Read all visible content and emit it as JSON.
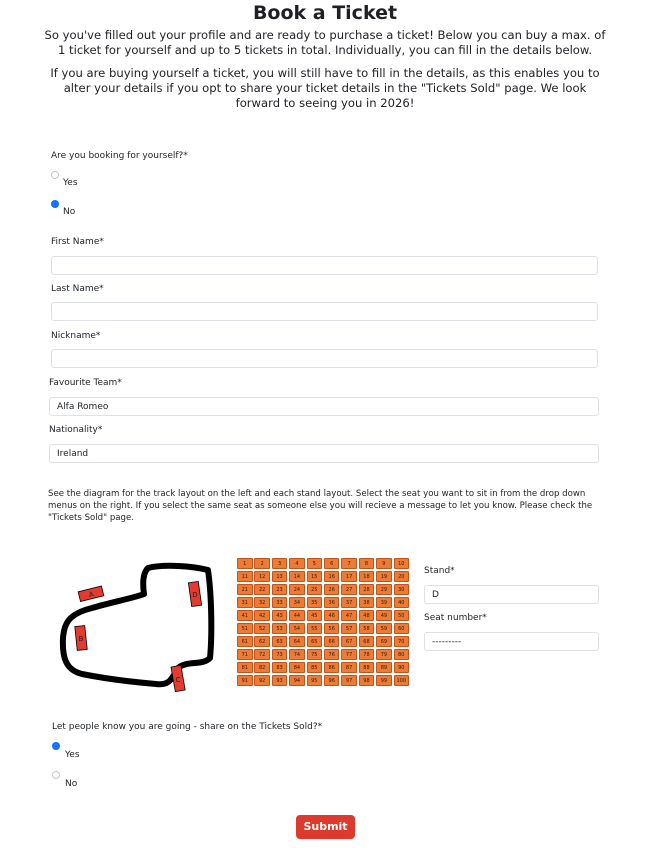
{
  "page": {
    "title": "Book a Ticket",
    "intro_1": "So you've filled out your profile and are ready to purchase a ticket! Below you can buy a max. of 1 ticket for yourself and up to 5 tickets in total. Individually, you can fill in the details below.",
    "intro_2": "If you are buying yourself a ticket, you will still have to fill in the details, as this enables you to alter your details if you opt to share your ticket details in the \"Tickets Sold\" page. We look forward to seeing you in 2026!"
  },
  "form": {
    "booking_self": {
      "label": "Are you booking for yourself?*",
      "options": [
        {
          "label": "Yes",
          "checked": false
        },
        {
          "label": "No",
          "checked": true
        }
      ]
    },
    "first_name": {
      "label": "First Name*",
      "value": ""
    },
    "last_name": {
      "label": "Last Name*",
      "value": ""
    },
    "nickname": {
      "label": "Nickname*",
      "value": ""
    },
    "favourite_team": {
      "label": "Favourite Team*",
      "value": "Alfa Romeo"
    },
    "nationality": {
      "label": "Nationality*",
      "value": "Ireland"
    },
    "seat_description": "See the diagram for the track layout on the left and each stand layout. Select the seat you want to sit in from the drop down menus on the right. If you select the same seat as someone else you will recieve a message to let you know. Please check the \"Tickets Sold\" page.",
    "stand": {
      "label": "Stand*",
      "value": "D"
    },
    "seat_number": {
      "label": "Seat number*",
      "value": "---------"
    },
    "share": {
      "label": "Let people know you are going - share on the Tickets Sold?*",
      "options": [
        {
          "label": "Yes",
          "checked": true
        },
        {
          "label": "No",
          "checked": false
        }
      ]
    },
    "submit_label": "Submit"
  },
  "track": {
    "stands": [
      "A",
      "B",
      "C",
      "D"
    ],
    "track_color": "#000000",
    "stand_color": "#e53a2f"
  },
  "seat_grid": {
    "seats": [
      1,
      2,
      3,
      4,
      5,
      6,
      7,
      8,
      9,
      10,
      11,
      12,
      13,
      14,
      15,
      16,
      17,
      18,
      19,
      20,
      21,
      22,
      23,
      24,
      25,
      26,
      27,
      28,
      29,
      30,
      31,
      32,
      33,
      34,
      35,
      36,
      37,
      38,
      39,
      40,
      41,
      42,
      43,
      44,
      45,
      46,
      47,
      48,
      49,
      50,
      51,
      52,
      53,
      54,
      55,
      56,
      57,
      58,
      59,
      60,
      61,
      62,
      63,
      64,
      65,
      66,
      67,
      68,
      69,
      70,
      71,
      72,
      73,
      74,
      75,
      76,
      77,
      78,
      79,
      80,
      81,
      82,
      83,
      84,
      85,
      86,
      87,
      88,
      89,
      90,
      91,
      92,
      93,
      94,
      95,
      96,
      97,
      98,
      99,
      100
    ],
    "seat_color": "#ee7b35"
  }
}
